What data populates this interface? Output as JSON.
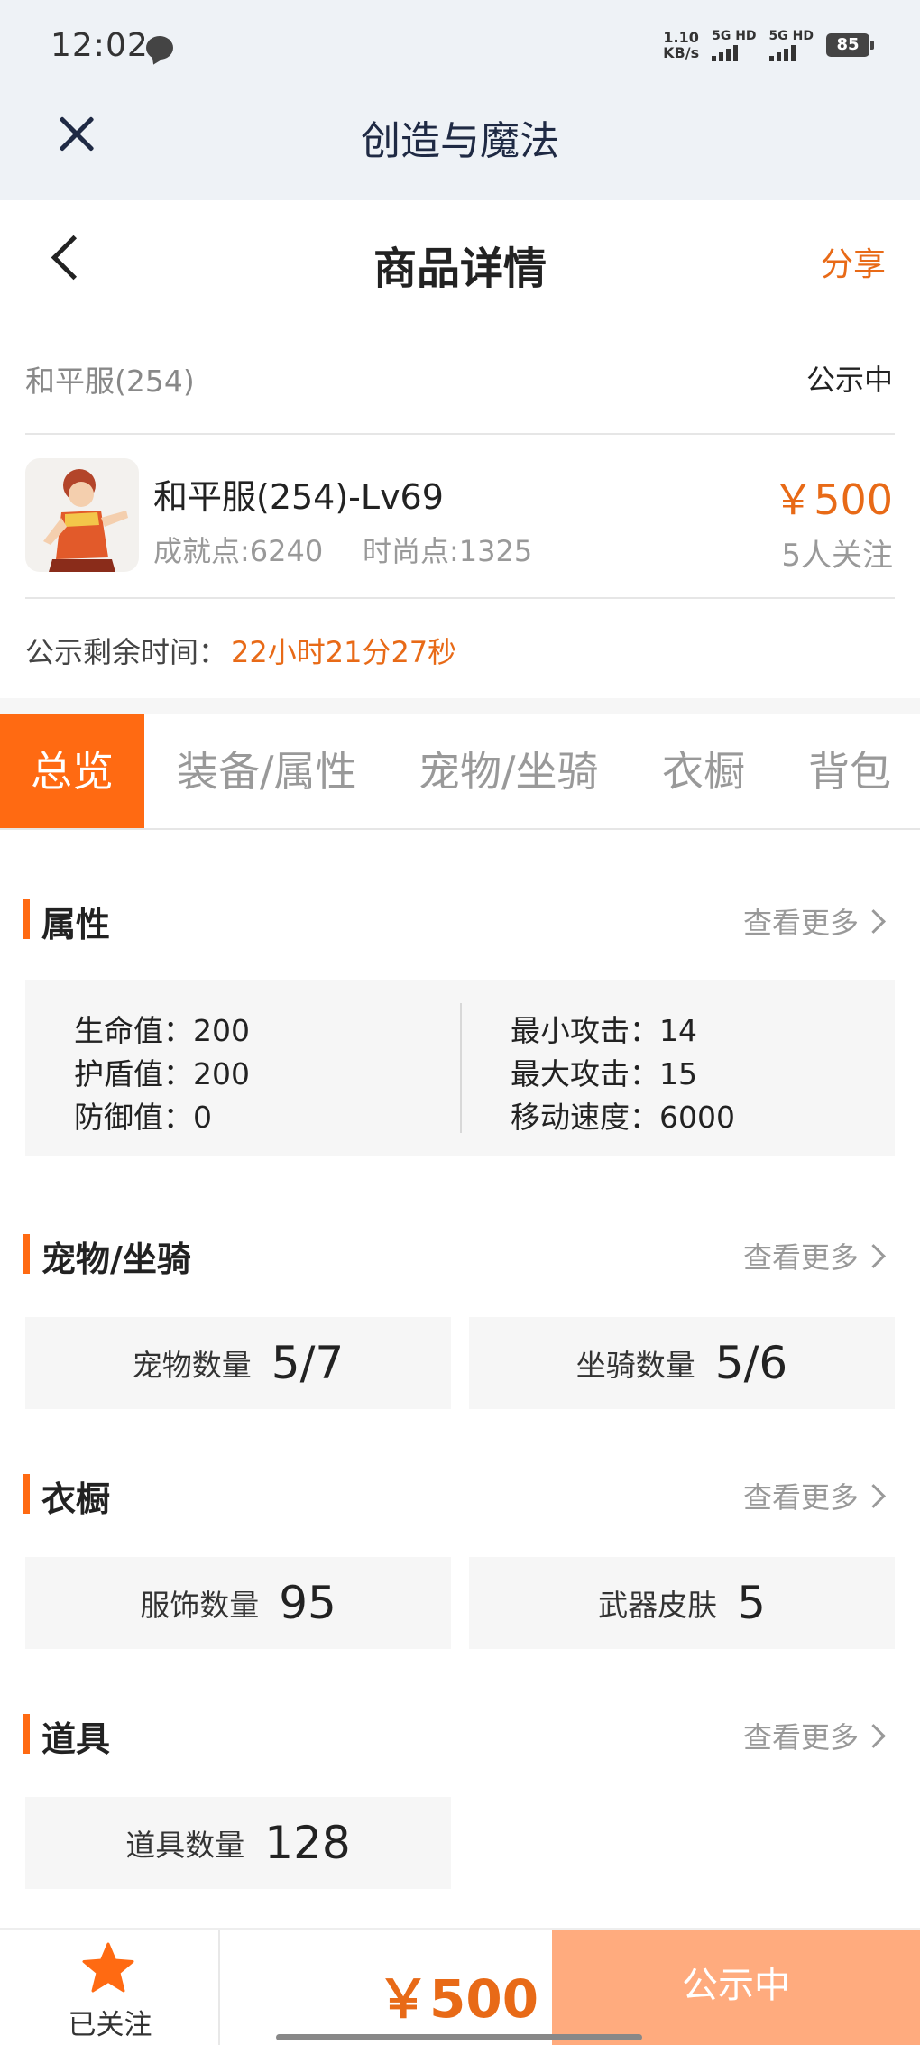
{
  "status_bar": {
    "time": "12:02",
    "net_speed_value": "1.10",
    "net_speed_unit": "KB/s",
    "signal1_label": "5G HD",
    "signal2_label": "5G HD",
    "battery": "85"
  },
  "app_header": {
    "title": "创造与魔法"
  },
  "nav": {
    "title": "商品详情",
    "share": "分享"
  },
  "listing": {
    "server": "和平服(254)",
    "status": "公示中",
    "product_name": "和平服(254)-Lv69",
    "achievement": "成就点:6240",
    "fashion": "时尚点:1325",
    "price": "￥500",
    "followers": "5人关注",
    "remaining_label": "公示剩余时间：",
    "remaining_value": "22小时21分27秒"
  },
  "tabs": [
    "总览",
    "装备/属性",
    "宠物/坐骑",
    "衣橱",
    "背包"
  ],
  "sections": {
    "attributes": {
      "title": "属性",
      "more": "查看更多",
      "left": [
        "生命值：200",
        "护盾值：200",
        "防御值：0"
      ],
      "right": [
        "最小攻击：14",
        "最大攻击：15",
        "移动速度：6000"
      ]
    },
    "pets": {
      "title": "宠物/坐骑",
      "more": "查看更多",
      "items": [
        {
          "label": "宠物数量",
          "value": "5/7"
        },
        {
          "label": "坐骑数量",
          "value": "5/6"
        }
      ]
    },
    "wardrobe": {
      "title": "衣橱",
      "more": "查看更多",
      "items": [
        {
          "label": "服饰数量",
          "value": "95"
        },
        {
          "label": "武器皮肤",
          "value": "5"
        }
      ]
    },
    "props": {
      "title": "道具",
      "more": "查看更多",
      "items": [
        {
          "label": "道具数量",
          "value": "128"
        }
      ]
    }
  },
  "bottom_bar": {
    "follow_label": "已关注",
    "price": "￥500",
    "status_button": "公示中"
  },
  "colors": {
    "accent": "#ff6a12",
    "price": "#e86a17",
    "status_button": "#ffab7e"
  }
}
